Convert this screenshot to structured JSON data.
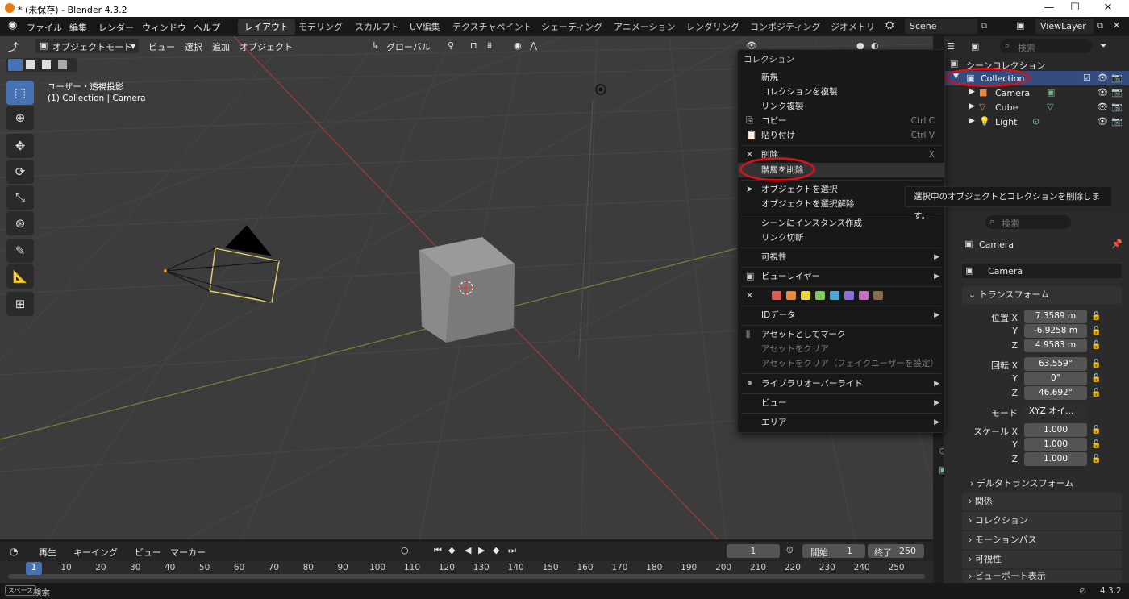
{
  "window": {
    "title": "* (未保存) - Blender 4.3.2",
    "min": "—",
    "max": "☐",
    "close": "✕"
  },
  "menubar": {
    "items": [
      "ファイル",
      "編集",
      "レンダー",
      "ウィンドウ",
      "ヘルプ"
    ],
    "workspaces": [
      "レイアウト",
      "モデリング",
      "スカルプト",
      "UV編集",
      "テクスチャペイント",
      "シェーディング",
      "アニメーション",
      "レンダリング",
      "コンポジティング",
      "ジオメトリ"
    ],
    "active_workspace": "レイアウト",
    "scene": "Scene",
    "view_layer": "ViewLayer"
  },
  "viewport_header": {
    "mode": "オブジェクトモード",
    "menus": [
      "ビュー",
      "選択",
      "追加",
      "オブジェクト"
    ],
    "orientation": "グローバル"
  },
  "viewport": {
    "view_name": "ユーザー・透視投影",
    "context": "(1) Collection | Camera",
    "cube_label": "Cube"
  },
  "outliner": {
    "search_placeholder": "検索",
    "root": "シーンコレクション",
    "collection": "Collection",
    "items": [
      "Camera",
      "Cube",
      "Light"
    ]
  },
  "context_menu": {
    "title": "コレクション",
    "items": [
      {
        "label": "新規"
      },
      {
        "label": "コレクションを複製"
      },
      {
        "label": "リンク複製"
      },
      {
        "label": "コピー",
        "shortcut": "Ctrl C"
      },
      {
        "label": "貼り付け",
        "shortcut": "Ctrl V"
      },
      {
        "label": "削除",
        "shortcut": "X"
      },
      {
        "label": "階層を削除"
      },
      {
        "label": "オブジェクトを選択"
      },
      {
        "label": "オブジェクトを選択解除"
      },
      {
        "label": "シーンにインスタンス作成"
      },
      {
        "label": "リンク切断"
      },
      {
        "label": "可視性"
      },
      {
        "label": "ビューレイヤー"
      },
      {
        "label": "IDデータ"
      },
      {
        "label": "アセットとしてマーク"
      },
      {
        "label": "アセットをクリア"
      },
      {
        "label": "アセットをクリア（フェイクユーザーを設定）"
      },
      {
        "label": "ライブラリオーバーライド"
      },
      {
        "label": "ビュー"
      },
      {
        "label": "エリア"
      }
    ],
    "color_tags": [
      "#e05a54",
      "#e88a3c",
      "#e8d23c",
      "#7ec95a",
      "#4aa8d6",
      "#8a6fd8",
      "#c56dc3",
      "#8a6a4d"
    ]
  },
  "tooltip": "選択中のオブジェクトとコレクションを削除します。",
  "properties": {
    "search_placeholder": "検索",
    "object_name": "Camera",
    "data_name": "Camera",
    "transform_title": "トランスフォーム",
    "location_label": "位置 X",
    "rotation_label": "回転 X",
    "scale_label": "スケール X",
    "y": "Y",
    "z": "Z",
    "location": [
      "7.3589 m",
      "-6.9258 m",
      "4.9583 m"
    ],
    "rotation": [
      "63.559°",
      "0°",
      "46.692°"
    ],
    "mode_label": "モード",
    "mode_value": "XYZ オイ...",
    "scale": [
      "1.000",
      "1.000",
      "1.000"
    ],
    "sections": [
      "デルタトランスフォーム",
      "関係",
      "コレクション",
      "モーションパス",
      "可視性",
      "ビューポート表示"
    ]
  },
  "timeline": {
    "menus": [
      "再生",
      "キーイング",
      "ビュー",
      "マーカー"
    ],
    "current_frame": "1",
    "start_label": "開始",
    "start": "1",
    "end_label": "終了",
    "end": "250",
    "ticks": [
      "1",
      "10",
      "20",
      "30",
      "40",
      "50",
      "60",
      "70",
      "80",
      "90",
      "100",
      "110",
      "120",
      "130",
      "140",
      "150",
      "160",
      "170",
      "180",
      "190",
      "200",
      "210",
      "220",
      "230",
      "240",
      "250"
    ]
  },
  "statusbar": {
    "key": "スペース",
    "action": "検索",
    "version": "4.3.2"
  }
}
